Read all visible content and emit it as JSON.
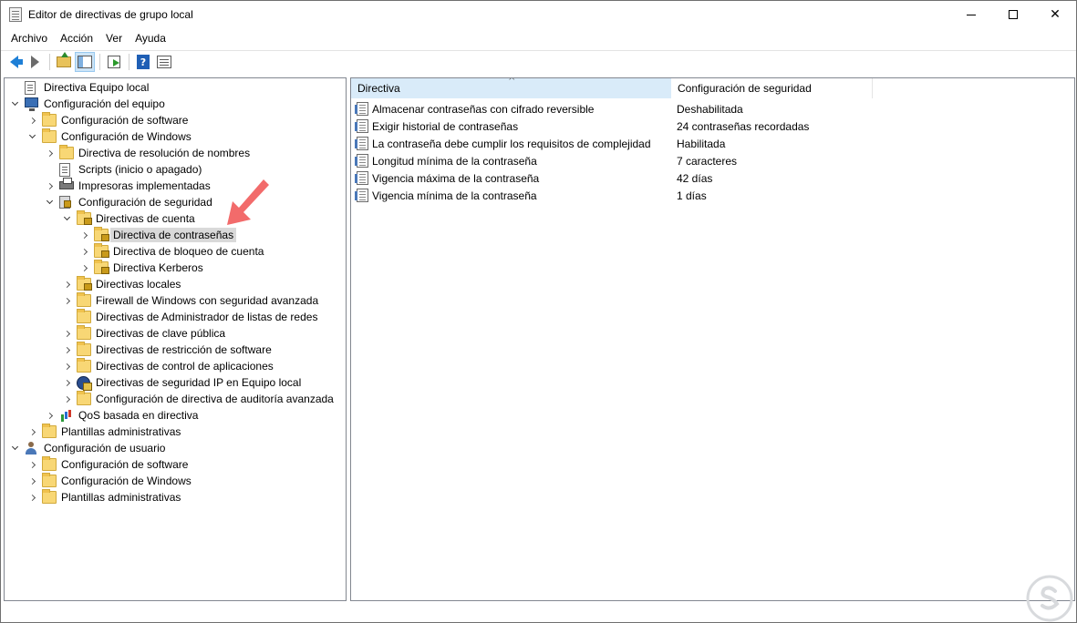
{
  "window": {
    "title": "Editor de directivas de grupo local"
  },
  "menu": [
    "Archivo",
    "Acción",
    "Ver",
    "Ayuda"
  ],
  "toolbar": [
    {
      "name": "back-icon"
    },
    {
      "name": "forward-icon"
    },
    {
      "name": "up-folder-icon"
    },
    {
      "name": "show-hide-console-tree-icon"
    },
    {
      "name": "export-list-icon"
    },
    {
      "name": "help-icon"
    },
    {
      "name": "filter-options-icon"
    }
  ],
  "tree": [
    {
      "label": "Directiva Equipo local",
      "indent": 0,
      "chevron": "none",
      "icon": "doc-icon"
    },
    {
      "label": "Configuración del equipo",
      "indent": 0,
      "chevron": "down",
      "icon": "computer-icon"
    },
    {
      "label": "Configuración de software",
      "indent": 1,
      "chevron": "right",
      "icon": "folder-icon"
    },
    {
      "label": "Configuración de Windows",
      "indent": 1,
      "chevron": "down",
      "icon": "folder-icon"
    },
    {
      "label": "Directiva de resolución de nombres",
      "indent": 2,
      "chevron": "right",
      "icon": "folder-icon"
    },
    {
      "label": "Scripts (inicio o apagado)",
      "indent": 2,
      "chevron": "none",
      "icon": "doc-icon"
    },
    {
      "label": "Impresoras implementadas",
      "indent": 2,
      "chevron": "right",
      "icon": "printer-icon"
    },
    {
      "label": "Configuración de seguridad",
      "indent": 2,
      "chevron": "down",
      "icon": "shield-icon"
    },
    {
      "label": "Directivas de cuenta",
      "indent": 3,
      "chevron": "down",
      "icon": "lock-folder-icon"
    },
    {
      "label": "Directiva de contraseñas",
      "indent": 4,
      "chevron": "right",
      "icon": "lock-folder-icon",
      "selected": true
    },
    {
      "label": "Directiva de bloqueo de cuenta",
      "indent": 4,
      "chevron": "right",
      "icon": "lock-folder-icon"
    },
    {
      "label": "Directiva Kerberos",
      "indent": 4,
      "chevron": "right",
      "icon": "lock-folder-icon"
    },
    {
      "label": "Directivas locales",
      "indent": 3,
      "chevron": "right",
      "icon": "lock-folder-icon"
    },
    {
      "label": "Firewall de Windows con seguridad avanzada",
      "indent": 3,
      "chevron": "right",
      "icon": "folder-icon"
    },
    {
      "label": "Directivas de Administrador de listas de redes",
      "indent": 3,
      "chevron": "none",
      "icon": "folder-icon"
    },
    {
      "label": "Directivas de clave pública",
      "indent": 3,
      "chevron": "right",
      "icon": "folder-icon"
    },
    {
      "label": "Directivas de restricción de software",
      "indent": 3,
      "chevron": "right",
      "icon": "folder-icon"
    },
    {
      "label": "Directivas de control de aplicaciones",
      "indent": 3,
      "chevron": "right",
      "icon": "folder-icon"
    },
    {
      "label": "Directivas de seguridad IP en Equipo local",
      "indent": 3,
      "chevron": "right",
      "icon": "ipsec-icon"
    },
    {
      "label": "Configuración de directiva de auditoría avanzada",
      "indent": 3,
      "chevron": "right",
      "icon": "folder-icon"
    },
    {
      "label": "QoS basada en directiva",
      "indent": 2,
      "chevron": "right",
      "icon": "qos-icon"
    },
    {
      "label": "Plantillas administrativas",
      "indent": 1,
      "chevron": "right",
      "icon": "folder-icon"
    },
    {
      "label": "Configuración de usuario",
      "indent": 0,
      "chevron": "down",
      "icon": "user-icon"
    },
    {
      "label": "Configuración de software",
      "indent": 1,
      "chevron": "right",
      "icon": "folder-icon"
    },
    {
      "label": "Configuración de Windows",
      "indent": 1,
      "chevron": "right",
      "icon": "folder-icon"
    },
    {
      "label": "Plantillas administrativas",
      "indent": 1,
      "chevron": "right",
      "icon": "folder-icon"
    }
  ],
  "list": {
    "columns": [
      "Directiva",
      "Configuración de seguridad"
    ],
    "rows": [
      {
        "policy": "Almacenar contraseñas con cifrado reversible",
        "setting": "Deshabilitada"
      },
      {
        "policy": "Exigir historial de contraseñas",
        "setting": "24 contraseñas recordadas"
      },
      {
        "policy": "La contraseña debe cumplir los requisitos de complejidad",
        "setting": "Habilitada"
      },
      {
        "policy": "Longitud mínima de la contraseña",
        "setting": "7 caracteres"
      },
      {
        "policy": "Vigencia máxima de la contraseña",
        "setting": "42 días"
      },
      {
        "policy": "Vigencia mínima de la contraseña",
        "setting": "1 días"
      }
    ]
  },
  "colors": {
    "accent_arrow": "#f26b6b",
    "sorted_header": "#d9ebf9",
    "selection": "#d9d9d9"
  }
}
